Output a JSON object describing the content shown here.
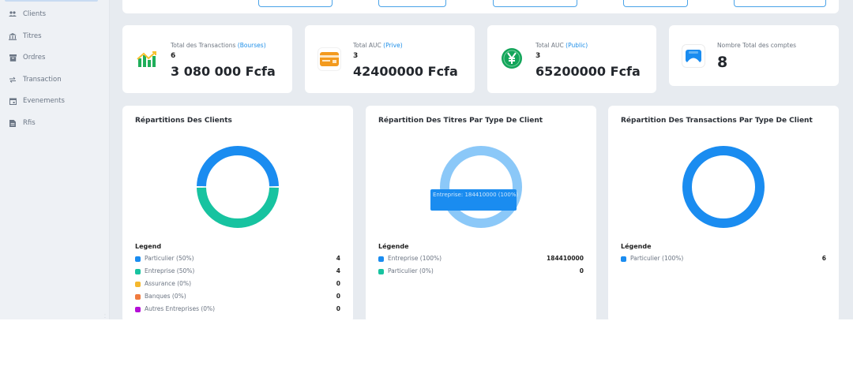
{
  "colors": {
    "blue": "#1a8cf0",
    "green": "#17c3a0",
    "yellow": "#f5b82e",
    "orange": "#f07b3f",
    "purple": "#b40fd6",
    "light_blue": "#8bc8f8",
    "accent": "#1e8fe8"
  },
  "sidebar": {
    "items": [
      {
        "label": "Clients",
        "icon": "users-icon"
      },
      {
        "label": "Titres",
        "icon": "bank-icon"
      },
      {
        "label": "Ordres",
        "icon": "archive-icon"
      },
      {
        "label": "Transaction",
        "icon": "transfer-icon"
      },
      {
        "label": "Evenements",
        "icon": "calendar-icon"
      },
      {
        "label": "Rfis",
        "icon": "document-icon"
      }
    ]
  },
  "stats": [
    {
      "label": "Total des Transactions ",
      "accent": "(Bourses)",
      "count": "6",
      "value": "3 080 000 Fcfa",
      "icon": "chart-bar-icon"
    },
    {
      "label": "Total AUC ",
      "accent": "(Prive)",
      "count": "3",
      "value": "42400000 Fcfa",
      "icon": "credit-card-icon"
    },
    {
      "label": "Total AUC ",
      "accent": "(Public)",
      "count": "3",
      "value": "65200000 Fcfa",
      "icon": "yen-coin-icon"
    },
    {
      "label": "Nombre Total des comptes",
      "accent": "",
      "count": "",
      "value": "8",
      "icon": "account-icon"
    }
  ],
  "panels": [
    {
      "title": "Répartitions Des Clients",
      "legend_title": "Legend",
      "legend": [
        {
          "label": "Particulier (50%)",
          "value": "4",
          "color": "#1a8cf0"
        },
        {
          "label": "Entreprise (50%)",
          "value": "4",
          "color": "#17c3a0"
        },
        {
          "label": "Assurance (0%)",
          "value": "0",
          "color": "#f5b82e"
        },
        {
          "label": "Banques (0%)",
          "value": "0",
          "color": "#f07b3f"
        },
        {
          "label": "Autres Entreprises (0%)",
          "value": "0",
          "color": "#b40fd6"
        }
      ]
    },
    {
      "title": "Répartition Des Titres Par Type De Client",
      "legend_title": "Légende",
      "tooltip": "Entreprise: 184410000 (100%)",
      "legend": [
        {
          "label": "Entreprise (100%)",
          "value": "184410000",
          "color": "#1a8cf0"
        },
        {
          "label": "Particulier (0%)",
          "value": "0",
          "color": "#17c3a0"
        }
      ]
    },
    {
      "title": "Répartition Des Transactions Par Type De Client",
      "legend_title": "Légende",
      "legend": [
        {
          "label": "Particulier (100%)",
          "value": "6",
          "color": "#1a8cf0"
        }
      ]
    }
  ],
  "chart_data": [
    {
      "type": "pie",
      "categories": [
        "Particulier",
        "Entreprise",
        "Assurance",
        "Banques",
        "Autres Entreprises"
      ],
      "values": [
        4,
        4,
        0,
        0,
        0
      ],
      "title": "Répartitions Des Clients"
    },
    {
      "type": "pie",
      "categories": [
        "Entreprise",
        "Particulier"
      ],
      "values": [
        184410000,
        0
      ],
      "title": "Répartition Des Titres Par Type De Client"
    },
    {
      "type": "pie",
      "categories": [
        "Particulier"
      ],
      "values": [
        6
      ],
      "title": "Répartition Des Transactions Par Type De Client"
    }
  ]
}
